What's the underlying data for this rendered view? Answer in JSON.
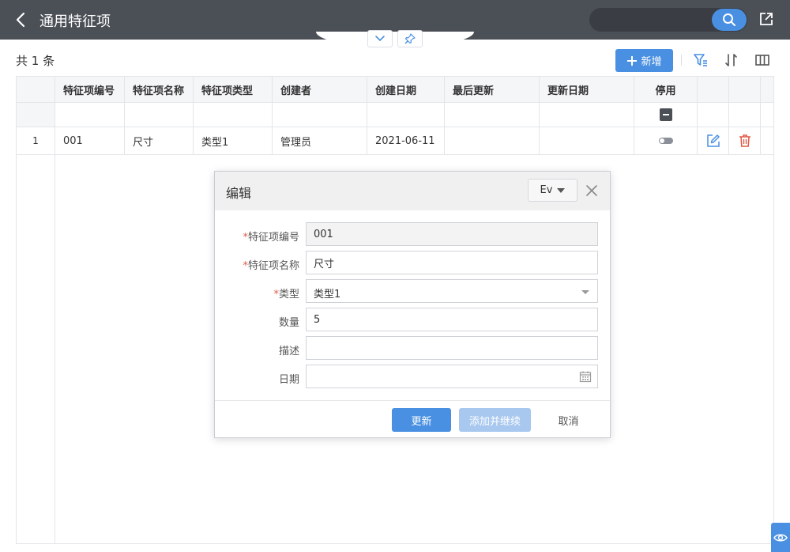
{
  "header": {
    "title": "通用特征项",
    "search_placeholder": "",
    "icons": {
      "back": "chevron-left-icon",
      "search": "search-icon",
      "share": "external-link-icon"
    }
  },
  "toolbar": {
    "count_label": "共 1 条",
    "add_label": "新增",
    "icons": [
      "plus-icon",
      "filter-icon",
      "sort-icon",
      "columns-icon"
    ]
  },
  "table": {
    "columns": [
      "特征项编号",
      "特征项名称",
      "特征项类型",
      "创建者",
      "创建日期",
      "最后更新",
      "更新日期",
      "停用"
    ],
    "rows": [
      {
        "index": "1",
        "code": "001",
        "name": "尺寸",
        "type": "类型1",
        "creator": "管理员",
        "created": "2021-06-11",
        "last_update": "",
        "updated": "",
        "disabled": false
      }
    ]
  },
  "dialog": {
    "title": "编辑",
    "lang_label": "Ev",
    "fields": [
      {
        "label": "特征项编号",
        "required": true,
        "value": "001",
        "readonly": true
      },
      {
        "label": "特征项名称",
        "required": true,
        "value": "尺寸"
      },
      {
        "label": "类型",
        "required": true,
        "value": "类型1",
        "kind": "select"
      },
      {
        "label": "数量",
        "required": false,
        "value": "5"
      },
      {
        "label": "描述",
        "required": false,
        "value": ""
      },
      {
        "label": "日期",
        "required": false,
        "value": "",
        "kind": "date"
      }
    ],
    "buttons": {
      "update": "更新",
      "add_continue": "添加并继续",
      "cancel": "取消"
    }
  },
  "colors": {
    "header_bg": "#4b4f56",
    "accent": "#4a90e2",
    "danger": "#e05a47"
  }
}
